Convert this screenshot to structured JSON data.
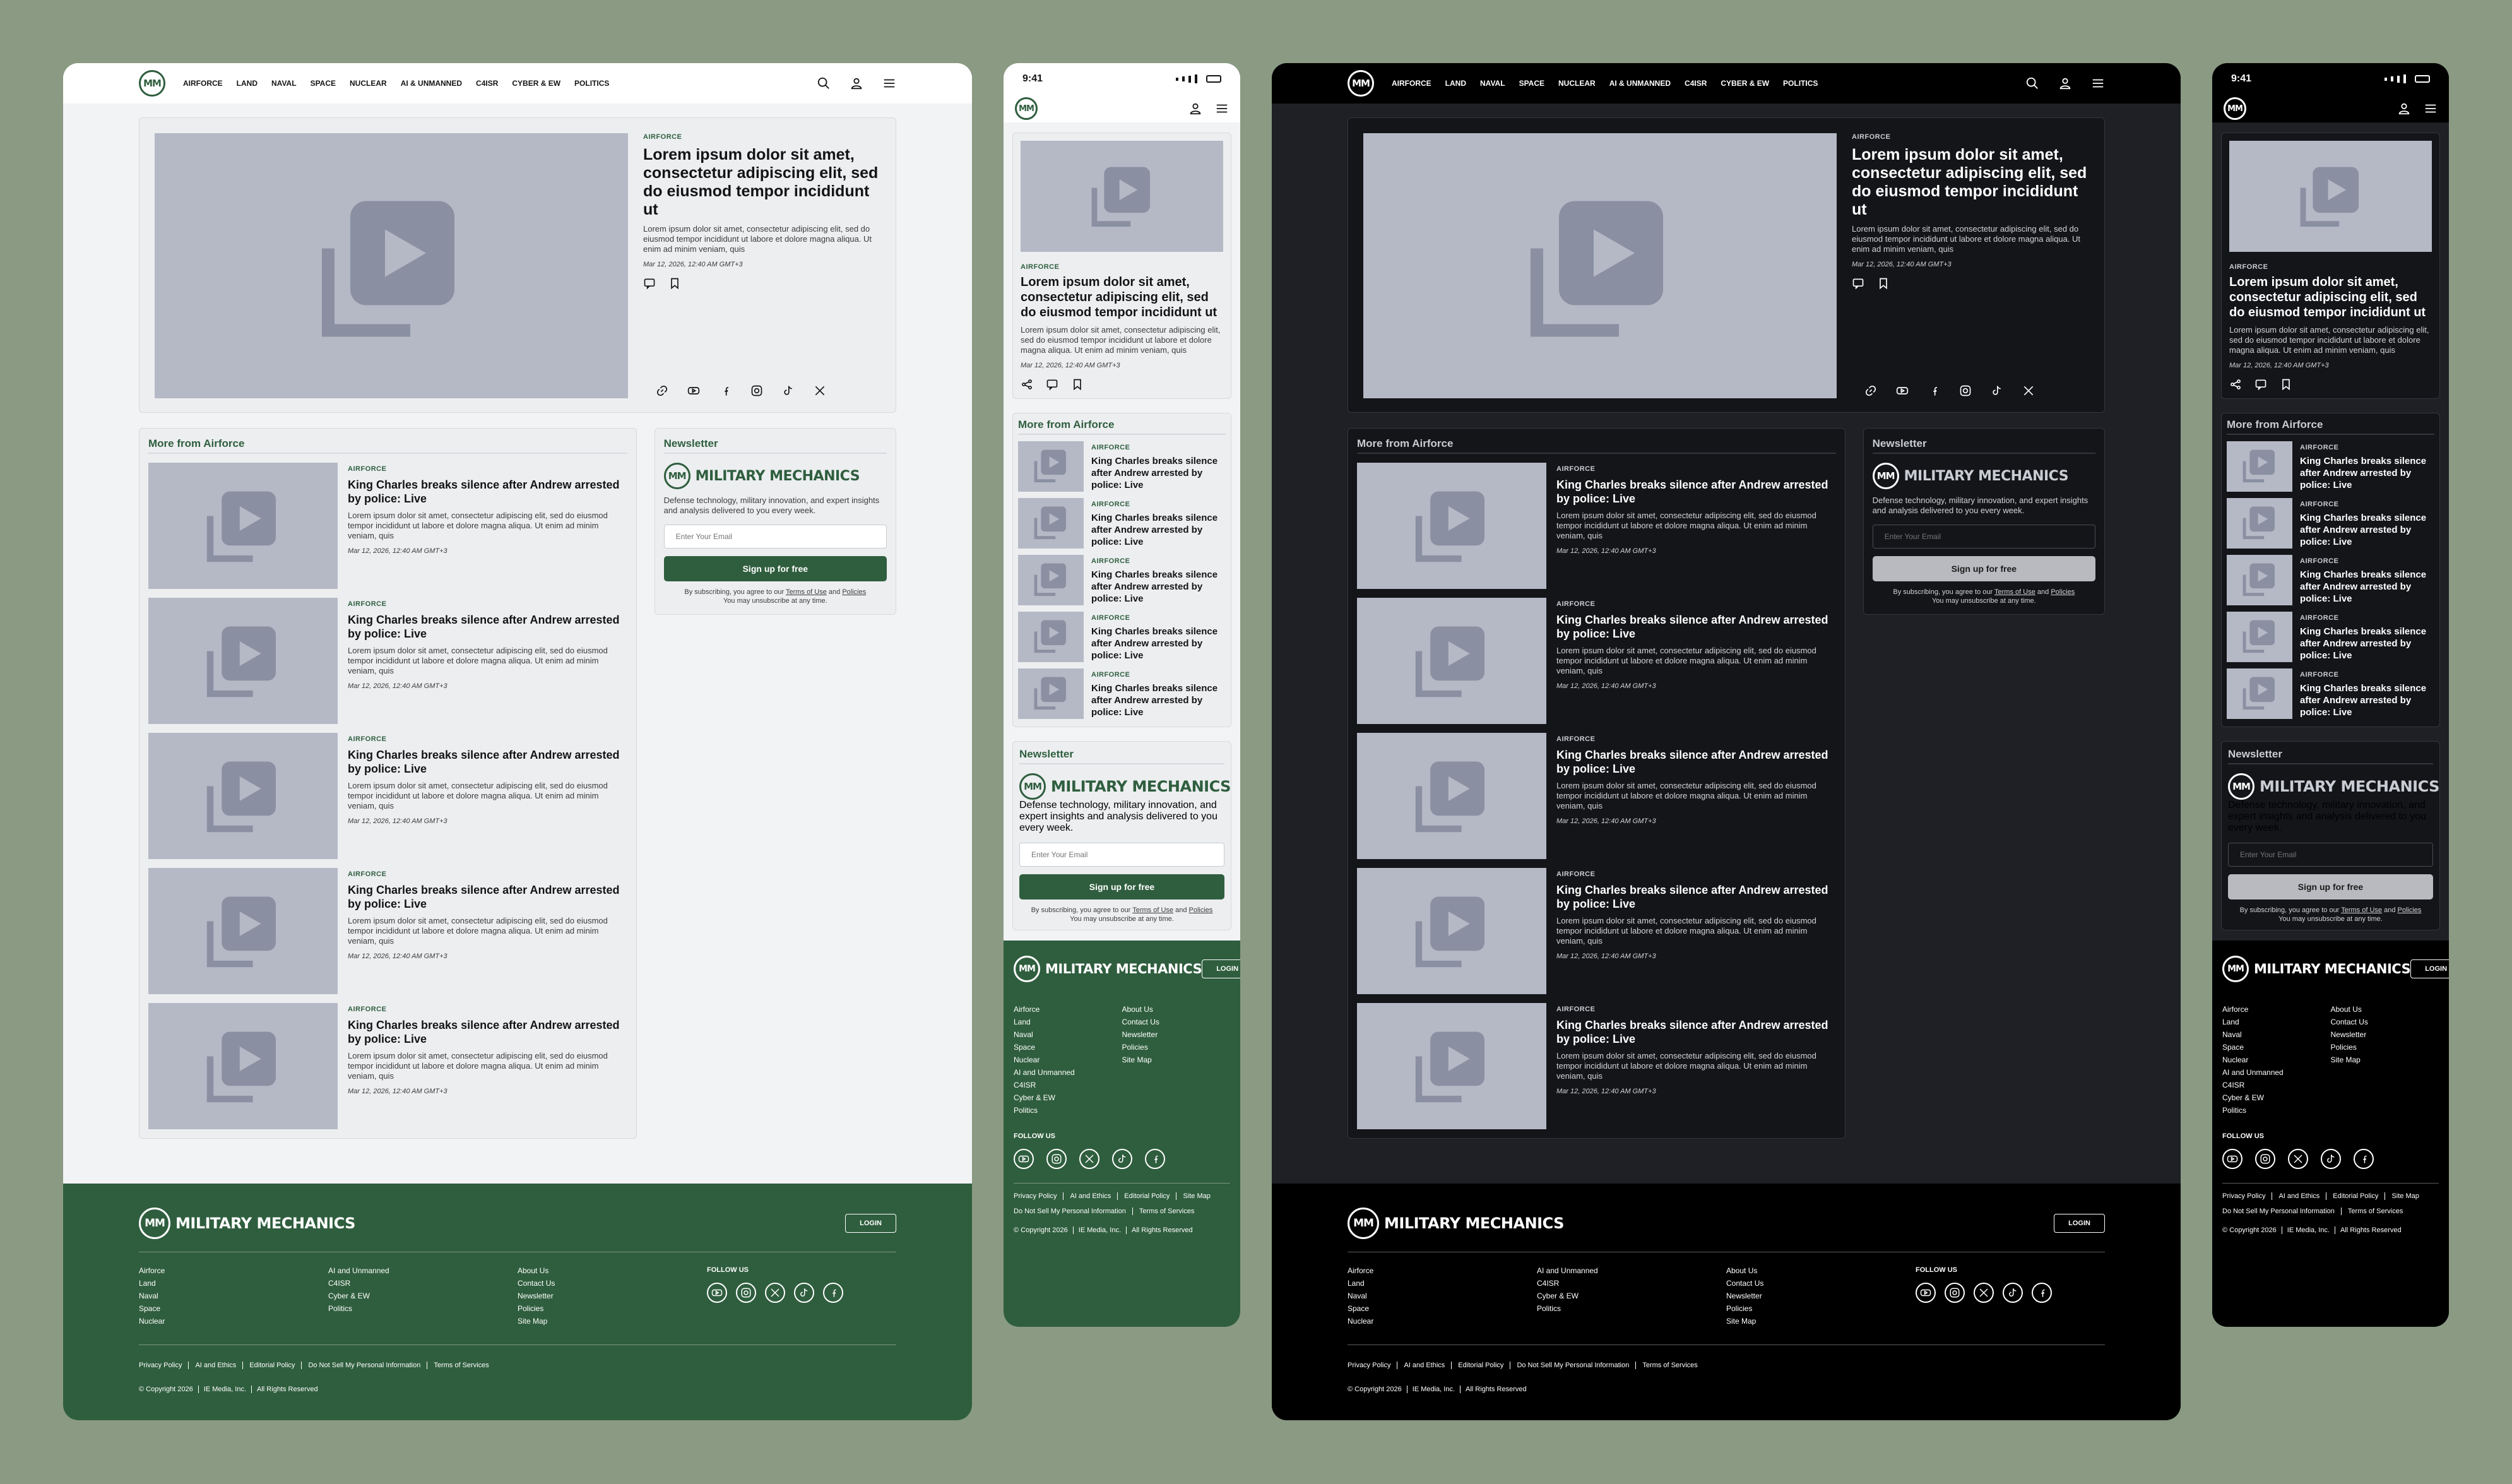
{
  "nav": {
    "logo_text": "MM",
    "links": [
      "AIRFORCE",
      "LAND",
      "NAVAL",
      "SPACE",
      "NUCLEAR",
      "AI & UNMANNED",
      "C4ISR",
      "CYBER & EW",
      "POLITICS"
    ]
  },
  "mobile_status": {
    "time": "9:41"
  },
  "hero": {
    "tag": "AIRFORCE",
    "title": "Lorem ipsum dolor sit amet, consectetur adipiscing elit, sed do eiusmod tempor incididunt ut",
    "summary": "Lorem ipsum dolor sit amet, consectetur adipiscing elit, sed do eiusmod tempor incididunt ut labore et dolore magna aliqua. Ut enim ad minim veniam, quis",
    "date": "Mar 12, 2026, 12:40 AM GMT+3"
  },
  "more": {
    "title": "More from Airforce",
    "articles": [
      {
        "tag": "AIRFORCE",
        "title": "King Charles breaks silence after Andrew arrested by police: Live",
        "summary": "Lorem ipsum dolor sit amet, consectetur adipiscing elit, sed do eiusmod tempor incididunt ut labore et dolore magna aliqua. Ut enim ad minim veniam, quis",
        "date": "Mar 12, 2026, 12:40 AM GMT+3"
      },
      {
        "tag": "AIRFORCE",
        "title": "King Charles breaks silence after Andrew arrested by police: Live",
        "summary": "Lorem ipsum dolor sit amet, consectetur adipiscing elit, sed do eiusmod tempor incididunt ut labore et dolore magna aliqua. Ut enim ad minim veniam, quis",
        "date": "Mar 12, 2026, 12:40 AM GMT+3"
      },
      {
        "tag": "AIRFORCE",
        "title": "King Charles breaks silence after Andrew arrested by police: Live",
        "summary": "Lorem ipsum dolor sit amet, consectetur adipiscing elit, sed do eiusmod tempor incididunt ut labore et dolore magna aliqua. Ut enim ad minim veniam, quis",
        "date": "Mar 12, 2026, 12:40 AM GMT+3"
      },
      {
        "tag": "AIRFORCE",
        "title": "King Charles breaks silence after Andrew arrested by police: Live",
        "summary": "Lorem ipsum dolor sit amet, consectetur adipiscing elit, sed do eiusmod tempor incididunt ut labore et dolore magna aliqua. Ut enim ad minim veniam, quis",
        "date": "Mar 12, 2026, 12:40 AM GMT+3"
      },
      {
        "tag": "AIRFORCE",
        "title": "King Charles breaks silence after Andrew arrested by police: Live",
        "summary": "Lorem ipsum dolor sit amet, consectetur adipiscing elit, sed do eiusmod tempor incididunt ut labore et dolore magna aliqua. Ut enim ad minim veniam, quis",
        "date": "Mar 12, 2026, 12:40 AM GMT+3"
      }
    ]
  },
  "newsletter": {
    "title": "Newsletter",
    "brand": "MILITARY MECHANICS",
    "description": "Defense technology, military innovation, and expert insights and analysis delivered to you every week.",
    "email_placeholder": "Enter Your Email",
    "button": "Sign up for free",
    "legal_prefix": "By subscribing, you agree to our",
    "terms": "Terms of Use",
    "and": "and",
    "policies": "Policies",
    "legal_suffix": "You may unsubscribe at any time."
  },
  "footer": {
    "brand": "MILITARY MECHANICS",
    "login": "LOGIN",
    "col1": [
      "Airforce",
      "Land",
      "Naval",
      "Space",
      "Nuclear"
    ],
    "col2": [
      "AI and Unmanned",
      "C4ISR",
      "Cyber & EW",
      "Politics"
    ],
    "col_mobile1": [
      "Airforce",
      "Land",
      "Naval",
      "Space",
      "Nuclear",
      "AI and Unmanned",
      "C4ISR",
      "Cyber & EW",
      "Politics"
    ],
    "col3": [
      "About Us",
      "Contact Us",
      "Newsletter",
      "Policies",
      "Site Map"
    ],
    "follow": "FOLLOW US",
    "legal": [
      "Privacy Policy",
      "AI and Ethics",
      "Editorial Policy",
      "Do Not Sell My Personal Information",
      "Terms of Services"
    ],
    "legal_mobile": [
      "Privacy Policy",
      "AI and Ethics",
      "Editorial Policy",
      "Site Map",
      "Do Not Sell My Personal Information",
      "Terms of Services"
    ],
    "copyright": [
      "© Copyright 2026",
      "IE Media, Inc.",
      "All Rights Reserved"
    ]
  },
  "icons": [
    "search-icon",
    "user-icon",
    "menu-icon",
    "comment-icon",
    "bookmark-icon",
    "link-icon",
    "youtube-icon",
    "facebook-icon",
    "instagram-icon",
    "tiktok-icon",
    "x-icon",
    "share-icon"
  ],
  "colors": {
    "brand_green": "#2f5e3e",
    "background": "#8a9a83",
    "placeholder": "#b5b9c6",
    "placeholder_icon": "#8a90a2",
    "dark_bg": "#1f2025",
    "dark_nav": "#000000"
  }
}
